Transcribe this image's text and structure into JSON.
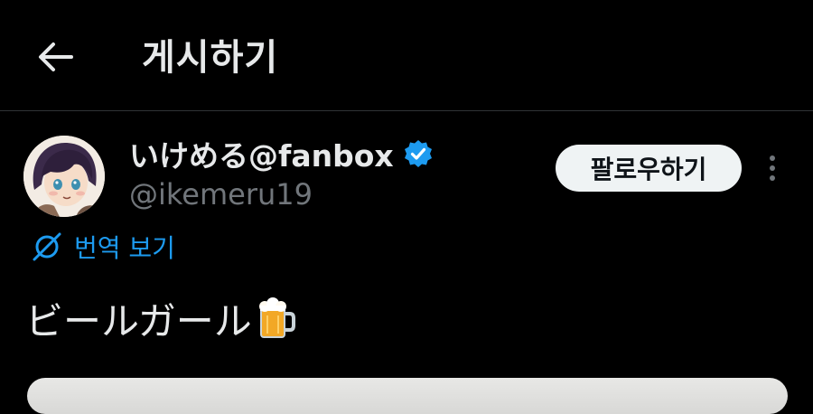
{
  "header": {
    "back_icon": "arrow-left-icon",
    "title": "게시하기"
  },
  "author": {
    "display_name": "いけめる@fanbox",
    "handle": "@ikemeru19",
    "verified_icon": "verified-badge-icon",
    "verified_color": "#1d9bf0"
  },
  "actions": {
    "follow_label": "팔로우하기",
    "more_icon": "more-vertical-icon"
  },
  "translate": {
    "icon": "globe-translate-icon",
    "label": "번역 보기"
  },
  "post": {
    "text": "ビールガール",
    "emoji_icon": "beer-mug-icon"
  },
  "colors": {
    "background": "#000000",
    "text_primary": "#e7e9ea",
    "text_secondary": "#71767b",
    "accent": "#1d9bf0",
    "follow_button_bg": "#eff3f4"
  }
}
